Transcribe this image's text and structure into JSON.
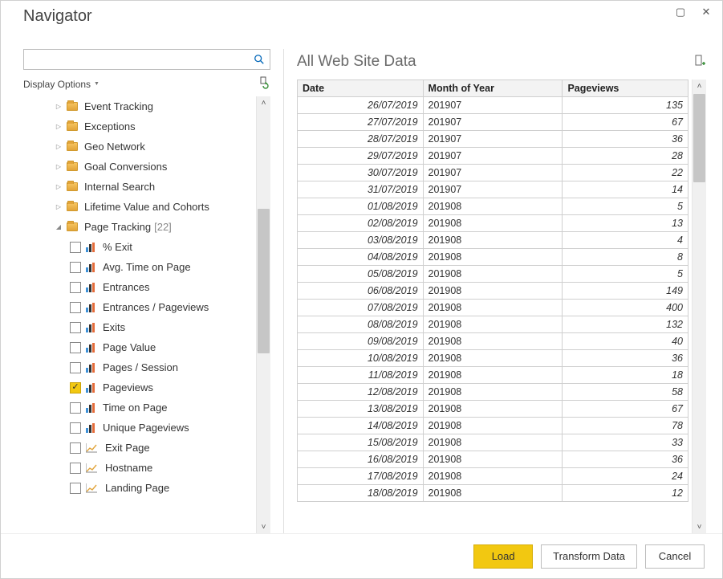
{
  "window": {
    "title": "Navigator"
  },
  "search": {
    "value": "",
    "placeholder": ""
  },
  "display_options_label": "Display Options",
  "tree": {
    "folders": [
      {
        "label": "Event Tracking"
      },
      {
        "label": "Exceptions"
      },
      {
        "label": "Geo Network"
      },
      {
        "label": "Goal Conversions"
      },
      {
        "label": "Internal Search"
      },
      {
        "label": "Lifetime Value and Cohorts"
      }
    ],
    "page_tracking": {
      "label": "Page Tracking",
      "count": "[22]"
    },
    "leaves": [
      {
        "label": "% Exit",
        "checked": false,
        "icon": "bars"
      },
      {
        "label": "Avg. Time on Page",
        "checked": false,
        "icon": "bars"
      },
      {
        "label": "Entrances",
        "checked": false,
        "icon": "bars"
      },
      {
        "label": "Entrances / Pageviews",
        "checked": false,
        "icon": "bars"
      },
      {
        "label": "Exits",
        "checked": false,
        "icon": "bars"
      },
      {
        "label": "Page Value",
        "checked": false,
        "icon": "bars"
      },
      {
        "label": "Pages / Session",
        "checked": false,
        "icon": "bars"
      },
      {
        "label": "Pageviews",
        "checked": true,
        "icon": "bars"
      },
      {
        "label": "Time on Page",
        "checked": false,
        "icon": "bars"
      },
      {
        "label": "Unique Pageviews",
        "checked": false,
        "icon": "bars"
      },
      {
        "label": "Exit Page",
        "checked": false,
        "icon": "line"
      },
      {
        "label": "Hostname",
        "checked": false,
        "icon": "line"
      },
      {
        "label": "Landing Page",
        "checked": false,
        "icon": "line"
      }
    ]
  },
  "preview": {
    "title": "All Web Site Data",
    "columns": {
      "c0": "Date",
      "c1": "Month of Year",
      "c2": "Pageviews"
    },
    "rows": [
      {
        "date": "26/07/2019",
        "month": "201907",
        "pv": "135"
      },
      {
        "date": "27/07/2019",
        "month": "201907",
        "pv": "67"
      },
      {
        "date": "28/07/2019",
        "month": "201907",
        "pv": "36"
      },
      {
        "date": "29/07/2019",
        "month": "201907",
        "pv": "28"
      },
      {
        "date": "30/07/2019",
        "month": "201907",
        "pv": "22"
      },
      {
        "date": "31/07/2019",
        "month": "201907",
        "pv": "14"
      },
      {
        "date": "01/08/2019",
        "month": "201908",
        "pv": "5"
      },
      {
        "date": "02/08/2019",
        "month": "201908",
        "pv": "13"
      },
      {
        "date": "03/08/2019",
        "month": "201908",
        "pv": "4"
      },
      {
        "date": "04/08/2019",
        "month": "201908",
        "pv": "8"
      },
      {
        "date": "05/08/2019",
        "month": "201908",
        "pv": "5"
      },
      {
        "date": "06/08/2019",
        "month": "201908",
        "pv": "149"
      },
      {
        "date": "07/08/2019",
        "month": "201908",
        "pv": "400"
      },
      {
        "date": "08/08/2019",
        "month": "201908",
        "pv": "132"
      },
      {
        "date": "09/08/2019",
        "month": "201908",
        "pv": "40"
      },
      {
        "date": "10/08/2019",
        "month": "201908",
        "pv": "36"
      },
      {
        "date": "11/08/2019",
        "month": "201908",
        "pv": "18"
      },
      {
        "date": "12/08/2019",
        "month": "201908",
        "pv": "58"
      },
      {
        "date": "13/08/2019",
        "month": "201908",
        "pv": "67"
      },
      {
        "date": "14/08/2019",
        "month": "201908",
        "pv": "78"
      },
      {
        "date": "15/08/2019",
        "month": "201908",
        "pv": "33"
      },
      {
        "date": "16/08/2019",
        "month": "201908",
        "pv": "36"
      },
      {
        "date": "17/08/2019",
        "month": "201908",
        "pv": "24"
      },
      {
        "date": "18/08/2019",
        "month": "201908",
        "pv": "12"
      }
    ]
  },
  "buttons": {
    "load": "Load",
    "transform": "Transform Data",
    "cancel": "Cancel"
  }
}
